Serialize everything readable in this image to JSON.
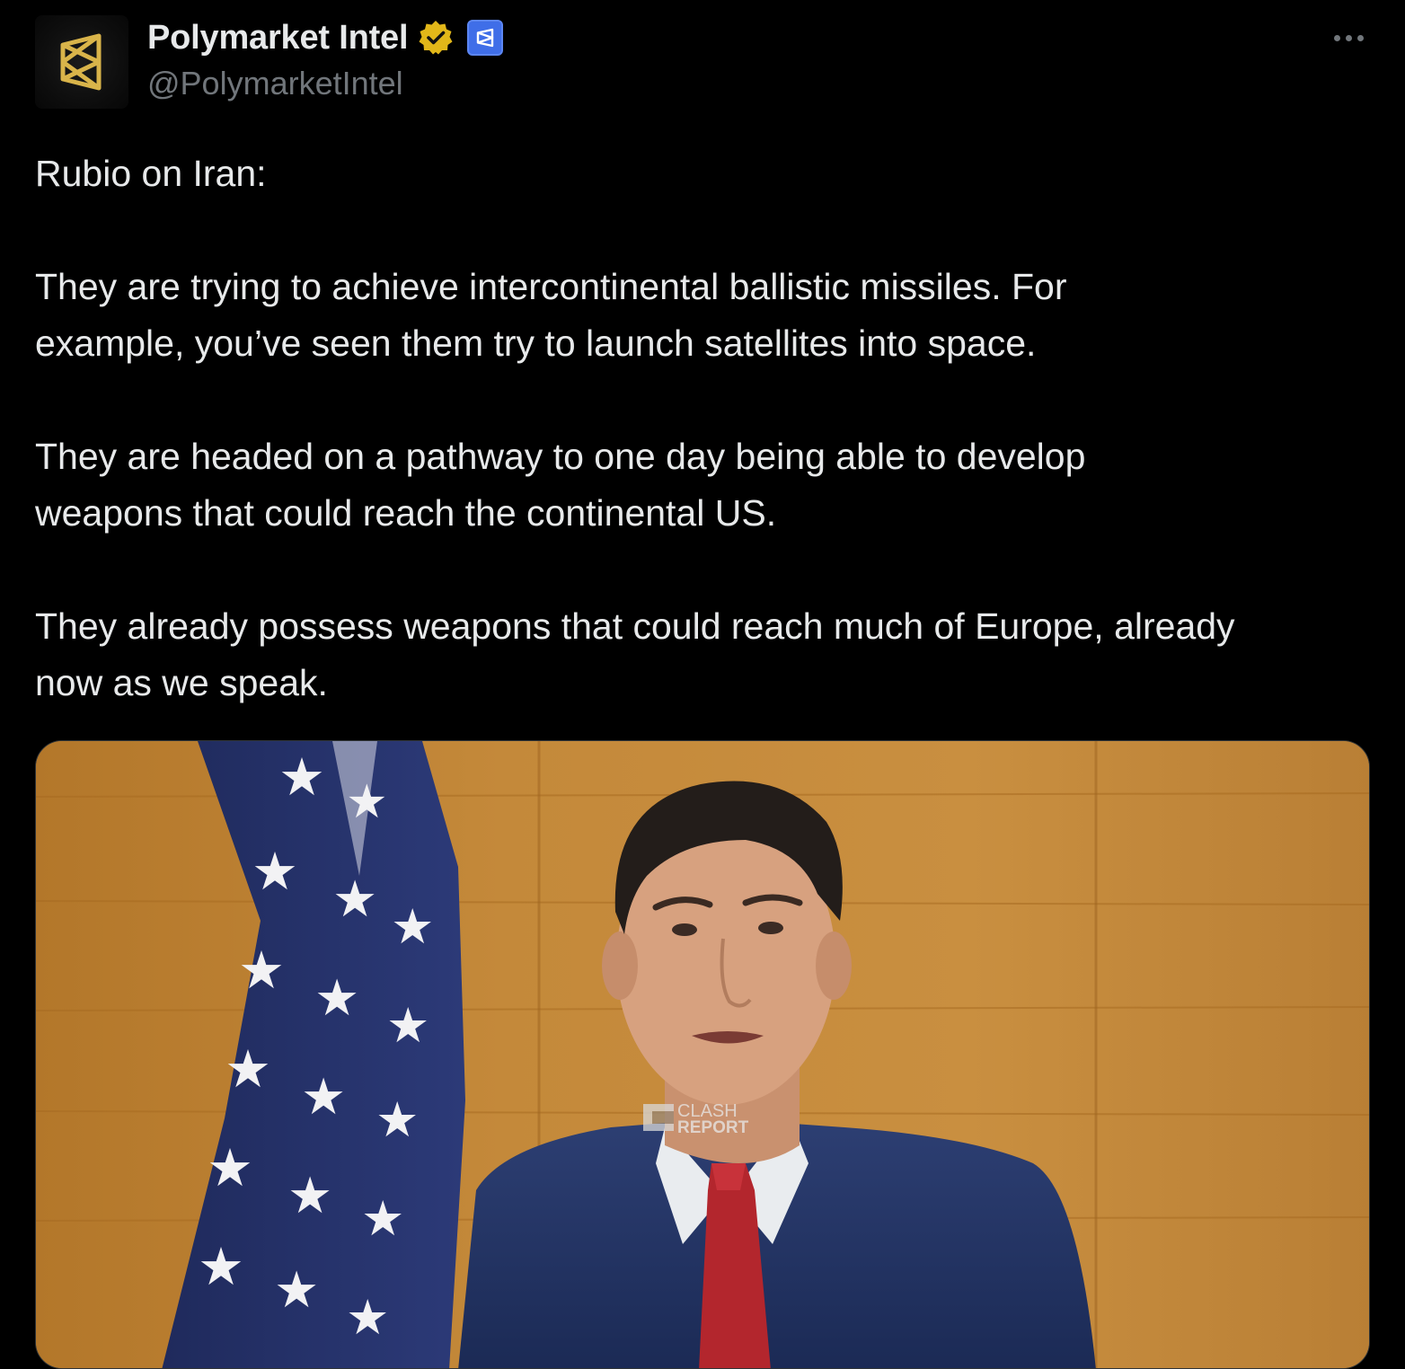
{
  "account": {
    "display_name": "Polymarket Intel",
    "handle": "@PolymarketIntel",
    "avatar_icon": "polymarket-logo",
    "verified_badge_icon": "gold-verified-badge",
    "affiliate_badge_icon": "polymarket-affiliate-badge"
  },
  "post": {
    "paragraphs": [
      "Rubio on Iran:",
      "They are trying to achieve intercontinental ballistic missiles. For example, you’ve seen them try to launch satellites into space.",
      "They are headed on a pathway to one day being able to develop weapons that could reach the continental US.",
      "They already possess weapons that could reach much of Europe, already now as we speak."
    ],
    "lines": [
      [
        "Rubio on Iran:"
      ],
      [
        "They are trying to achieve intercontinental ballistic missiles. For",
        "example, you’ve seen them try to launch satellites into space."
      ],
      [
        "They are headed on a pathway to one day being able to develop",
        "weapons that could reach the continental US."
      ],
      [
        "They already possess weapons that could reach much of Europe, already",
        "now as we speak."
      ]
    ]
  },
  "media": {
    "watermark_line1": "CLASH",
    "watermark_line2": "REPORT"
  },
  "more_icon": "more-horizontal-icon",
  "colors": {
    "background": "#000000",
    "text_primary": "#e7e9ea",
    "text_secondary": "#71767b",
    "verified_gold": "#e2b719",
    "affiliate_blue": "#3f6ee8",
    "logo_gold": "#d9b44a"
  }
}
